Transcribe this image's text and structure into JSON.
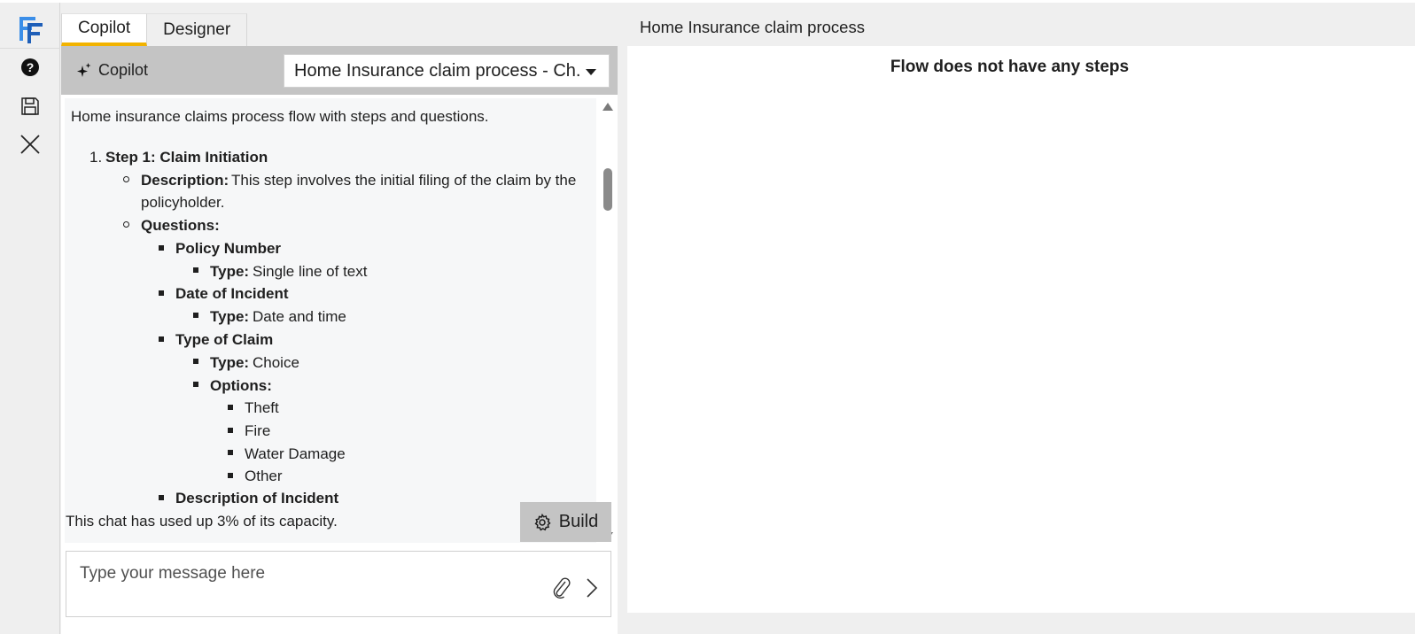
{
  "app": {
    "logo_text": "FF",
    "rail": {
      "help_icon": "help-circle-icon",
      "save_icon": "save-icon",
      "close_icon": "close-icon"
    }
  },
  "tabs": [
    {
      "label": "Copilot",
      "active": true
    },
    {
      "label": "Designer",
      "active": false
    }
  ],
  "copilot": {
    "title": "Copilot",
    "selected_flow": "Home Insurance claim process - Ch...",
    "intro": "Home insurance claims process flow with steps and questions.",
    "steps": [
      {
        "number": "1.",
        "title": "Step 1: Claim Initiation",
        "description_label": "Description:",
        "description_line1": "This step involves the initial filing of the claim by the",
        "description_line2": "policyholder.",
        "questions_label": "Questions:",
        "questions": [
          {
            "name": "Policy Number",
            "type_label": "Type:",
            "type": "Single line of text"
          },
          {
            "name": "Date of Incident",
            "type_label": "Type:",
            "type": "Date and time"
          },
          {
            "name": "Type of Claim",
            "type_label": "Type:",
            "type": "Choice",
            "options_label": "Options:",
            "options": [
              "Theft",
              "Fire",
              "Water Damage",
              "Other"
            ]
          },
          {
            "name": "Description of Incident"
          }
        ]
      }
    ],
    "capacity_text": "This chat has used up 3% of its capacity.",
    "build_label": "Build",
    "message_placeholder": "Type your message here"
  },
  "designer": {
    "title": "Home Insurance claim process",
    "empty_message": "Flow does not have any steps"
  },
  "colors": {
    "accent": "#f2b300",
    "header_gray": "#c4c4c4",
    "logo_blue": "#2f7fd8"
  }
}
